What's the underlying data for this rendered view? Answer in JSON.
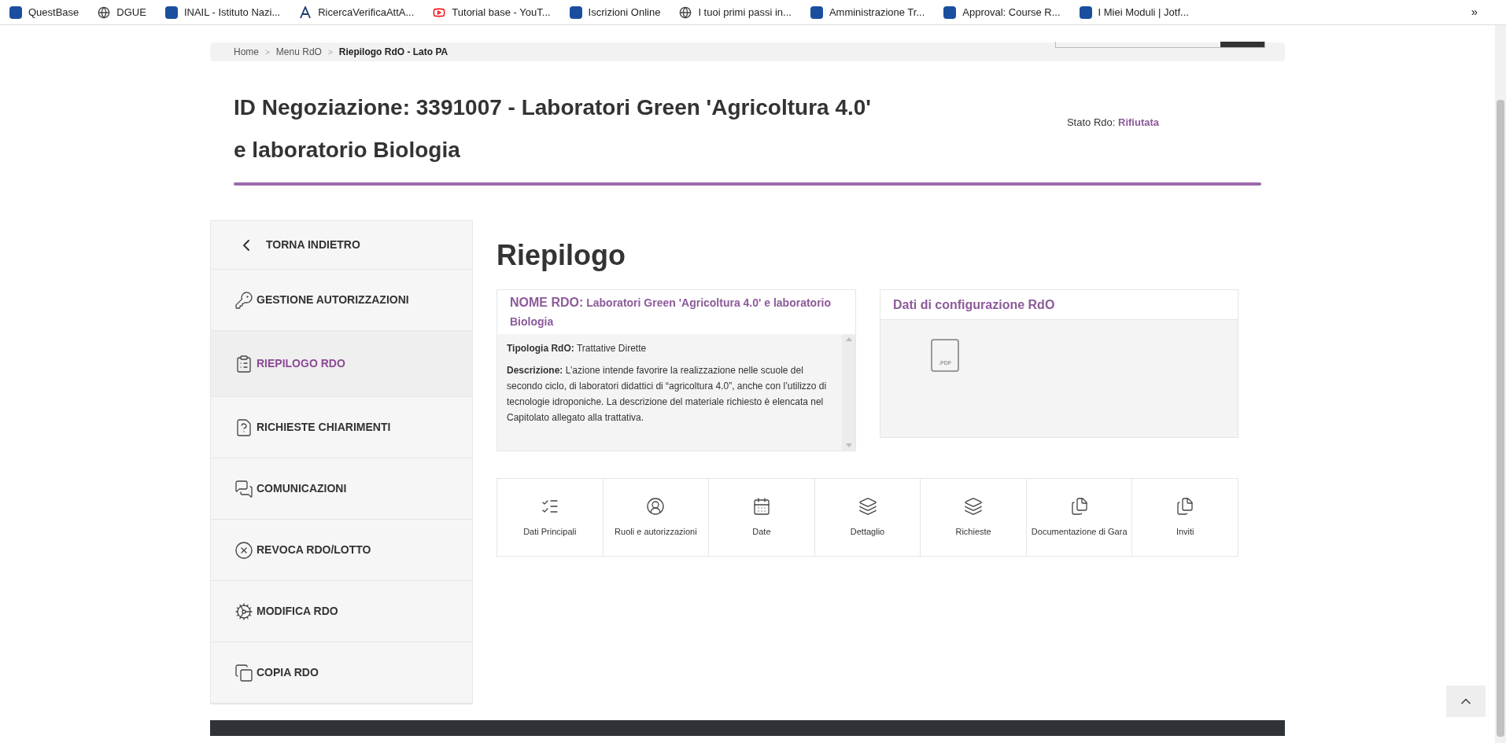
{
  "bookmarks": [
    {
      "label": "QuestBase",
      "kind": "logo"
    },
    {
      "label": "DGUE",
      "kind": "globe"
    },
    {
      "label": "INAIL - Istituto Nazi...",
      "kind": "logo"
    },
    {
      "label": "RicercaVerificaAttA...",
      "kind": "letter"
    },
    {
      "label": "Tutorial base - YouT...",
      "kind": "video"
    },
    {
      "label": "Iscrizioni Online",
      "kind": "logo"
    },
    {
      "label": "I tuoi primi passi in...",
      "kind": "globe"
    },
    {
      "label": "Amministrazione Tr...",
      "kind": "logo"
    },
    {
      "label": "Approval: Course R...",
      "kind": "logo"
    },
    {
      "label": "I Miei Moduli | Jotf...",
      "kind": "logo"
    }
  ],
  "bookmarks_more": "»",
  "breadcrumb": [
    {
      "label": "Home",
      "current": false
    },
    {
      "label": "Menu RdO",
      "current": false
    },
    {
      "label": "Riepilogo RdO - Lato PA",
      "current": true
    }
  ],
  "breadcrumb_separator": ">",
  "title_lines": [
    "ID Negoziazione: 3391007 - Laboratori Green 'Agricoltura 4.0'",
    "e laboratorio Biologia"
  ],
  "status": {
    "label": "Stato Rdo:",
    "value": "Rifiutata"
  },
  "sidebar": {
    "back": "TORNA INDIETRO",
    "items": [
      {
        "label": "GESTIONE AUTORIZZAZIONI",
        "kind": "keys",
        "selected": false
      },
      {
        "label": "RIEPILOGO RDO",
        "kind": "clipboard",
        "selected": true
      },
      {
        "label": "RICHIESTE CHIARIMENTI",
        "kind": "question",
        "selected": false
      },
      {
        "label": "COMUNICAZIONI",
        "kind": "chat",
        "selected": false
      },
      {
        "label": "REVOCA RDO/LOTTO",
        "kind": "revoke",
        "selected": false
      },
      {
        "label": "MODIFICA RDO",
        "kind": "gears",
        "selected": false
      },
      {
        "label": "COPIA RDO",
        "kind": "copy",
        "selected": false
      }
    ]
  },
  "heading": "Riepilogo",
  "summary": {
    "name_label": "NOME RDO:",
    "name": "Laboratori Green 'Agricoltura 4.0' e laboratorio Biologia",
    "type_line": "**Tipologia RdO:** Trattative Dirette",
    "description": "**Descrizione:** L’azione intende favorire la realizzazione nelle scuole del secondo ciclo, di laboratori didattici di “agricoltura 4.0”, anche con l’utilizzo di tecnologie idroponiche. La descrizione del materiale richiesto è elencata nel Capitolato allegato alla trattativa."
  },
  "config": {
    "title": "Dati di configurazione RdO",
    "file_label": ".PDF"
  },
  "tiles": [
    {
      "label": "Dati Principali",
      "kind": "list"
    },
    {
      "label": "Ruoli e autorizzazioni",
      "kind": "person"
    },
    {
      "label": "Date",
      "kind": "calendar"
    },
    {
      "label": "Dettaglio",
      "kind": "layers"
    },
    {
      "label": "Richieste",
      "kind": "layers"
    },
    {
      "label": "Documentazione di Gara",
      "kind": "docs"
    },
    {
      "label": "Inviti",
      "kind": "docs"
    }
  ]
}
